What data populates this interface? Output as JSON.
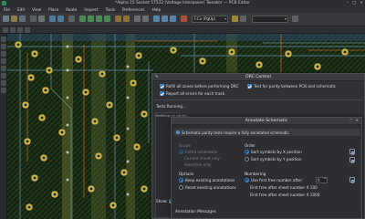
{
  "window": {
    "title": "*Alpha 15 Socket 57522 (Voltage Interposer) Tweaker — PCB Editor",
    "controls": [
      "–",
      "□",
      "×"
    ]
  },
  "menu": {
    "items": [
      "File",
      "Edit",
      "View",
      "Place",
      "Route",
      "Inspect",
      "Tools",
      "Preferences",
      "Help"
    ]
  },
  "toolbar": {
    "layer_select": "F.Cu (PgUp)",
    "net_select": ""
  },
  "drc": {
    "title": "DRC Control",
    "options": {
      "refill_zones": "Refill all zones before performing DRC",
      "report_all": "Report all errors for each track",
      "test_parity": "Test for parity between PCB and schematic"
    },
    "status": "Tests Running...",
    "progress_line": "Refilling all zones...",
    "show_label": "Show:"
  },
  "annotate": {
    "title": "Annotate Schematic",
    "info": "Schematic parity tests require a fully annotated schematic.",
    "scope": {
      "header": "Scope",
      "entire": "Entire schematic",
      "current_sheet": "Current sheet only",
      "selection": "Selection only"
    },
    "order": {
      "header": "Order",
      "sort_x": "Sort symbols by X position",
      "sort_y": "Sort symbols by Y position"
    },
    "options": {
      "header": "Options",
      "keep": "Keep existing annotations",
      "reset": "Reset existing annotations"
    },
    "numbering": {
      "header": "Numbering",
      "first_free": "Use first free number after:",
      "first_free_value": "0",
      "sheet_100": "First free after sheet number X 100",
      "sheet_1000": "First free after sheet number X 1000"
    },
    "messages_header": "Annotation Messages"
  }
}
